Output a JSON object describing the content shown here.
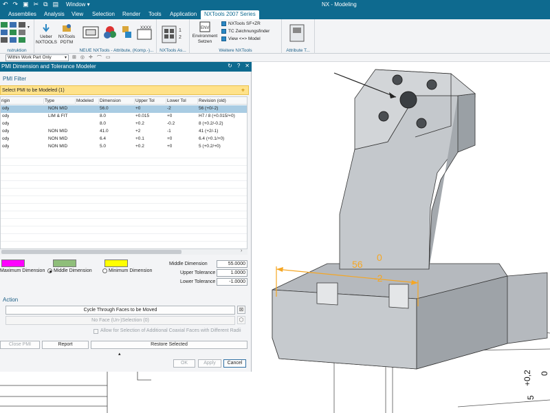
{
  "titlebar": {
    "window_menu": "Window ▾",
    "app_title": "NX - Modeling"
  },
  "menu": {
    "items": [
      "Assemblies",
      "Analysis",
      "View",
      "Selection",
      "Render",
      "Tools",
      "Application",
      "NXTools 2007 Series"
    ],
    "active": "NXTools 2007 Series"
  },
  "ribbon": {
    "construction_label": "nstruktion",
    "ueber_label": "Ueber NXTOOLS",
    "pdtm_label": "NXTools PDTM",
    "neue_group_label": "NEUE NXTools - Attribute, (Komp.-)...",
    "nxtools_as_label": "NXTools As...",
    "env_label": "Environment Setzen",
    "sf_zr_label": "NXTools SF+ZR",
    "tc_label": "TC Zeichnungsfinder",
    "view_model_label": "View <=> Model",
    "weitere_label": "Weitere NXTools",
    "attribute_t_label": "Attribute T..."
  },
  "seltoolbar": {
    "filter_value": "Within Work Part Only"
  },
  "dialog": {
    "title": "PMI Dimension and Tolerance Modeler",
    "pmi_filter": "PMI Filter",
    "select_label": "Select PMI to be Modeled (1)",
    "columns": [
      "rigin",
      "Type",
      "Modeled",
      "Dimension",
      "Upper Tol",
      "Lower Tol",
      "Revision (old)"
    ],
    "rows": [
      [
        "ody",
        "NON MID",
        "",
        "56.0",
        "+0",
        "-2",
        "56 (+0/-2)"
      ],
      [
        "ody",
        "LIM & FIT",
        "",
        "8.0",
        "+0.015",
        "+0",
        "H7 / 8 (+0.015/+0)"
      ],
      [
        "ody",
        "",
        "",
        "8.0",
        "+0.2",
        "-0.2",
        "8 (+0.2/-0.2)"
      ],
      [
        "ody",
        "NON MID",
        "",
        "41.0",
        "+2",
        "-1",
        "41 (+2/-1)"
      ],
      [
        "ody",
        "NON MID",
        "",
        "6.4",
        "+0.1",
        "+0",
        "6.4 (+0.1/+0)"
      ],
      [
        "ody",
        "NON MID",
        "",
        "5.0",
        "+0.2",
        "+0",
        "5 (+0.2/+0)"
      ]
    ],
    "selected_row": 0,
    "max_dim_label": "Maximum Dimension",
    "mid_dim_label": "Middle Dimension",
    "min_dim_label": "Minimum Dimension",
    "middle_dimension_label": "Middle Dimension",
    "middle_dimension_value": "55.0000",
    "upper_tolerance_label": "Upper Tolerance",
    "upper_tolerance_value": "1.0000",
    "lower_tolerance_label": "Lower Tolerance",
    "lower_tolerance_value": "-1.0000",
    "action_header": "Action",
    "cycle_label": "Cycle Through Faces to be Moved",
    "no_face_label": "No Face (Un-)Selection (0)",
    "allow_label": "Allow for Selection of Additional Coaxial Faces with Different Radii",
    "close_pmi_label": "Close PMI",
    "report_label": "Report",
    "restore_label": "Restore Selected",
    "ok_label": "OK",
    "apply_label": "Apply",
    "cancel_label": "Cancel"
  },
  "graphics": {
    "dim_value": "56",
    "dim_upper": "0",
    "dim_lower": "-2",
    "right_text_1": "+0,2",
    "right_text_2": "0",
    "right_text_3": "5"
  },
  "colors": {
    "title_blue": "#0e6a8f",
    "select_yellow": "#ffe28a",
    "max_swatch": "#ff00ff",
    "mid_swatch": "#8fbe7a",
    "min_swatch": "#ffff00",
    "dimension_orange": "#f5a623"
  }
}
